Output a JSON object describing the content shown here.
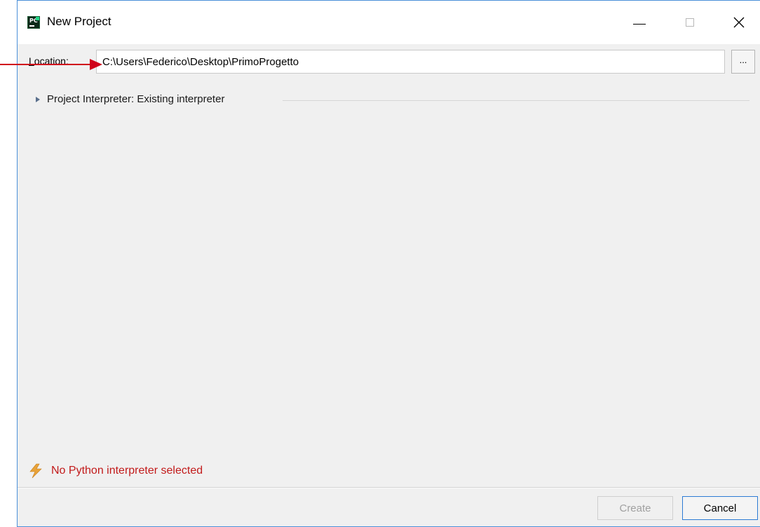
{
  "window": {
    "title": "New Project",
    "app_icon_text": "PC"
  },
  "form": {
    "location_label_mnemonic": "L",
    "location_label_rest": "ocation:",
    "location_value": "C:\\Users\\Federico\\Desktop\\PrimoProgetto",
    "browse_label": "..."
  },
  "interpreter_section": {
    "label": "Project Interpreter: Existing interpreter",
    "expanded": false
  },
  "warning": {
    "text": "No Python interpreter selected",
    "color": "#c21a1a"
  },
  "buttons": {
    "create_label": "Create",
    "cancel_label": "Cancel"
  },
  "colors": {
    "annotation_arrow": "#d0021b",
    "dialog_border": "#4a90d9",
    "default_button_border": "#2d7bd4"
  }
}
